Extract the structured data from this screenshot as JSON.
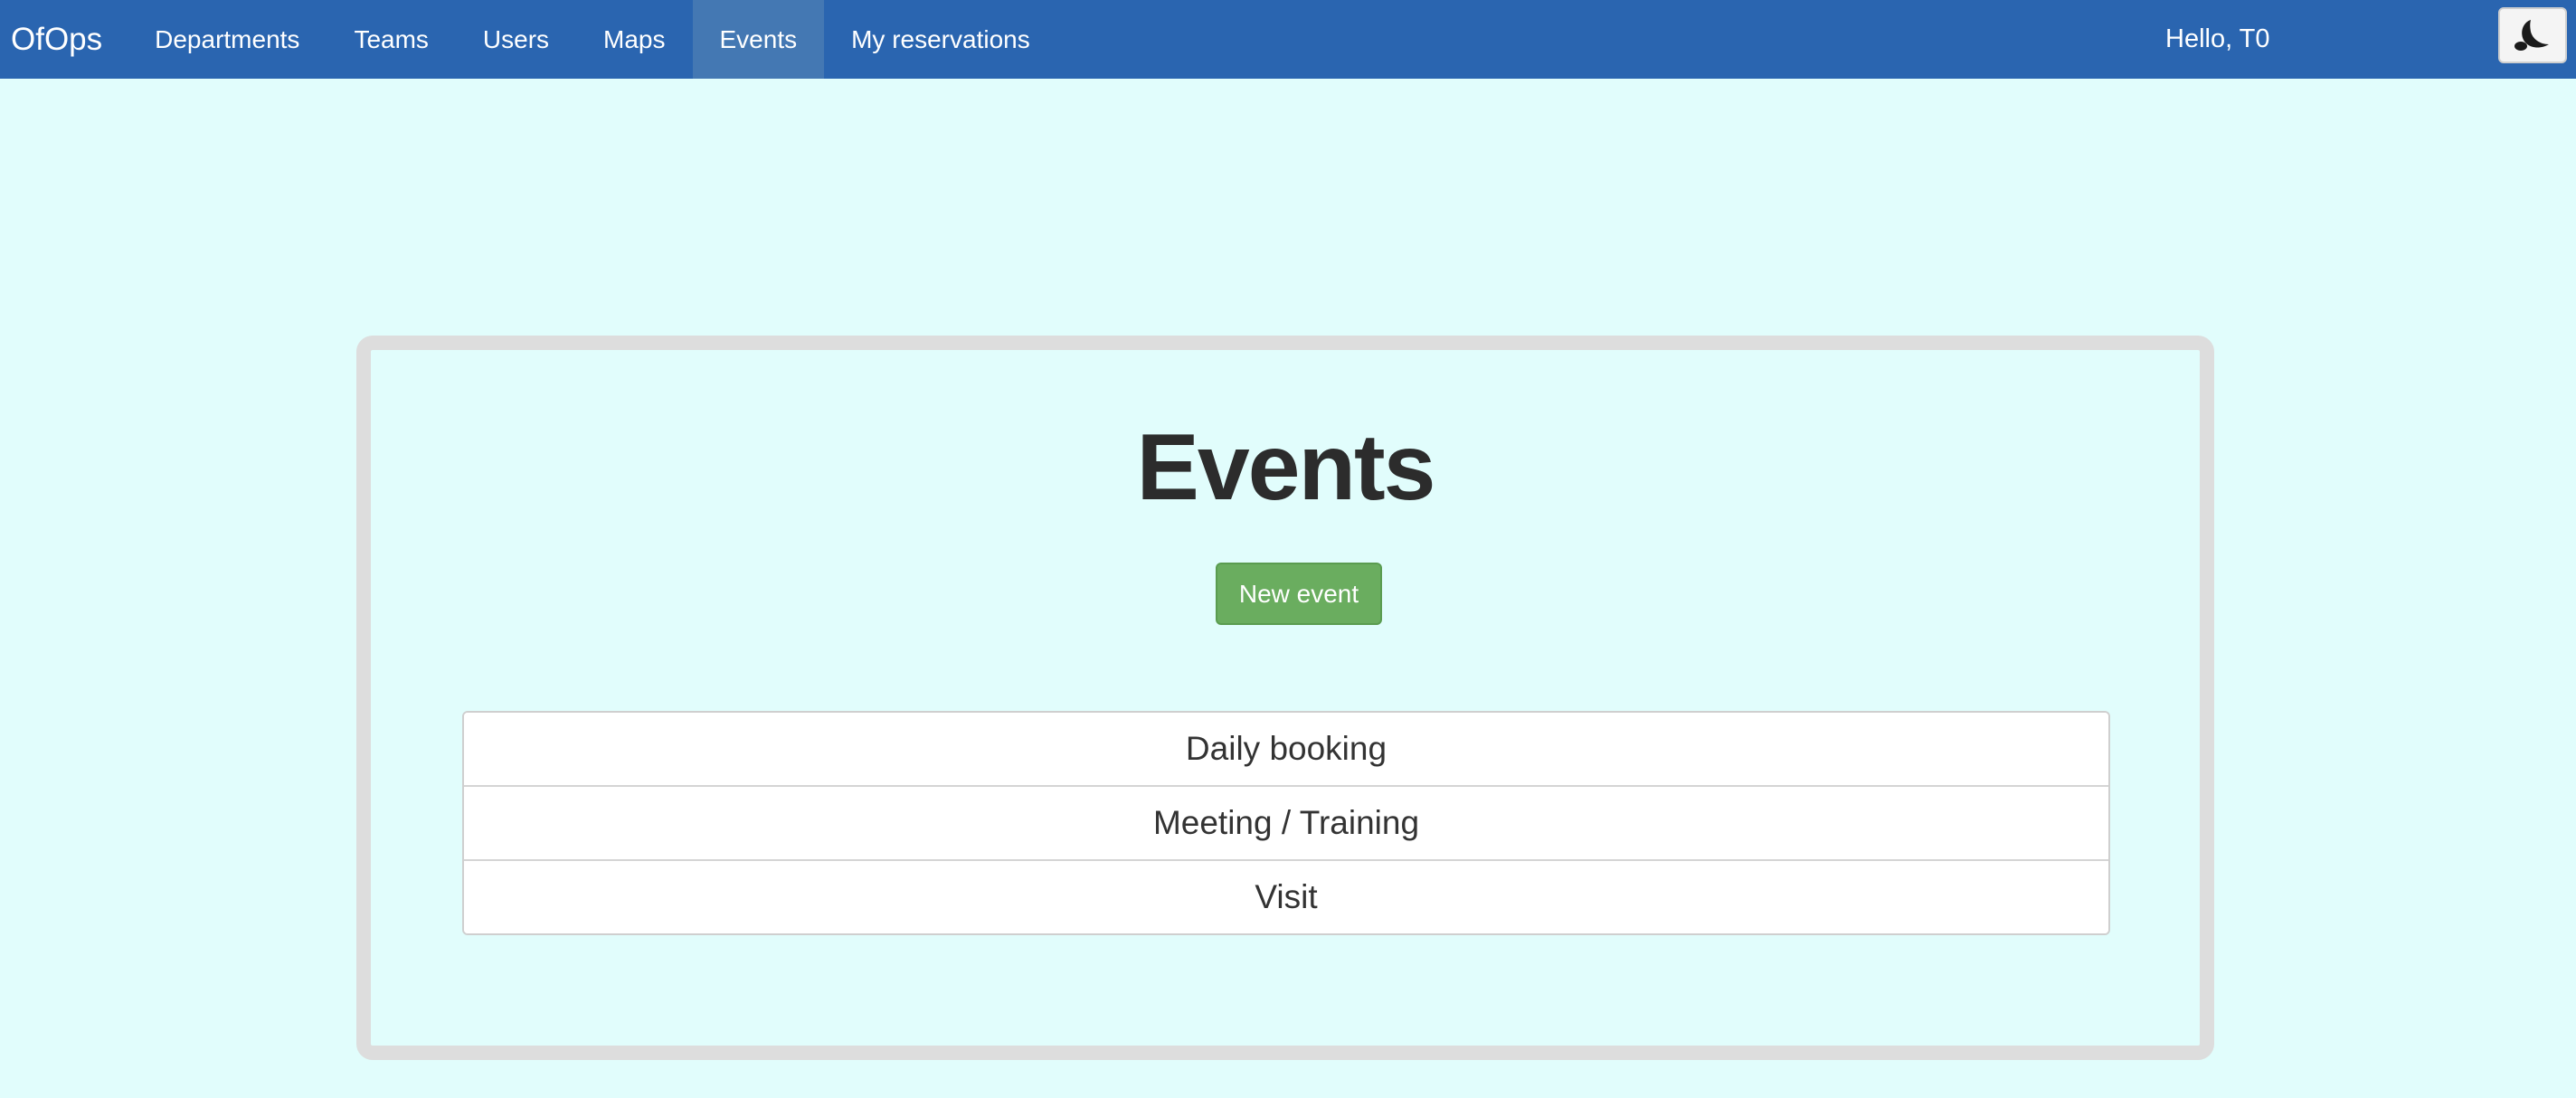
{
  "navbar": {
    "brand": "OfOps",
    "items": [
      {
        "label": "Departments",
        "active": false
      },
      {
        "label": "Teams",
        "active": false
      },
      {
        "label": "Users",
        "active": false
      },
      {
        "label": "Maps",
        "active": false
      },
      {
        "label": "Events",
        "active": true
      },
      {
        "label": "My reservations",
        "active": false
      }
    ],
    "greeting": "Hello, T0",
    "theme_toggle_icon": "moon-icon"
  },
  "main": {
    "title": "Events",
    "new_button_label": "New event",
    "events": [
      {
        "label": "Daily booking"
      },
      {
        "label": "Meeting / Training"
      },
      {
        "label": "Visit"
      }
    ]
  },
  "colors": {
    "navbar_bg": "#2a65b0",
    "page_bg": "#e1fdfc",
    "button_green": "#6aad5f",
    "card_border": "#dddddd"
  }
}
